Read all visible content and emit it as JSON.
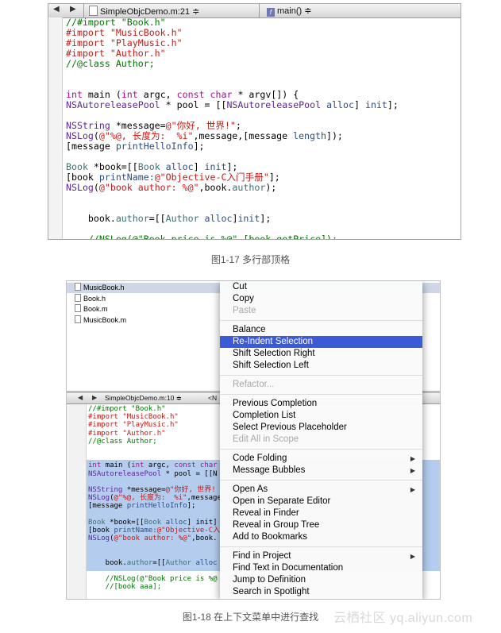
{
  "figure1": {
    "nav": {
      "back_arrow": "◀",
      "forward_arrow": "▶",
      "file_label": "SimpleObjcDemo.m:21 ≑",
      "function_label": "main() ≑",
      "function_icon": "f"
    },
    "code_lines": [
      {
        "y": 0,
        "parts": [
          {
            "t": "//#import \"Book.h\"",
            "c": "c-com"
          }
        ]
      },
      {
        "y": 1,
        "parts": [
          {
            "t": "#import ",
            "c": "c-red"
          },
          {
            "t": "\"MusicBook.h\"",
            "c": "c-red"
          }
        ]
      },
      {
        "y": 2,
        "parts": [
          {
            "t": "#import ",
            "c": "c-red"
          },
          {
            "t": "\"PlayMusic.h\"",
            "c": "c-red"
          }
        ]
      },
      {
        "y": 3,
        "parts": [
          {
            "t": "#import ",
            "c": "c-red"
          },
          {
            "t": "\"Author.h\"",
            "c": "c-red"
          }
        ]
      },
      {
        "y": 4,
        "parts": [
          {
            "t": "//@class Author;",
            "c": "c-com"
          }
        ]
      },
      {
        "y": 7,
        "parts": [
          {
            "t": "int",
            "c": "c-purple"
          },
          {
            "t": " main (",
            "c": ""
          },
          {
            "t": "int",
            "c": "c-purple"
          },
          {
            "t": " argc, ",
            "c": ""
          },
          {
            "t": "const",
            "c": "c-purple"
          },
          {
            "t": " ",
            "c": ""
          },
          {
            "t": "char",
            "c": "c-purple"
          },
          {
            "t": " * argv[]) {",
            "c": ""
          }
        ]
      },
      {
        "y": 8,
        "parts": [
          {
            "t": "NSAutoreleasePool",
            "c": "c-cls"
          },
          {
            "t": " * pool = [[",
            "c": ""
          },
          {
            "t": "NSAutoreleasePool",
            "c": "c-cls"
          },
          {
            "t": " ",
            "c": ""
          },
          {
            "t": "alloc",
            "c": "c-slate"
          },
          {
            "t": "] ",
            "c": ""
          },
          {
            "t": "init",
            "c": "c-slate"
          },
          {
            "t": "];",
            "c": ""
          }
        ]
      },
      {
        "y": 10,
        "parts": [
          {
            "t": "NSString",
            "c": "c-cls"
          },
          {
            "t": " *message=",
            "c": ""
          },
          {
            "t": "@\"你好, 世界!\"",
            "c": "c-red"
          },
          {
            "t": ";",
            "c": ""
          }
        ]
      },
      {
        "y": 11,
        "parts": [
          {
            "t": "NSLog",
            "c": "c-cls"
          },
          {
            "t": "(",
            "c": ""
          },
          {
            "t": "@\"%@, 长度为:  %i\"",
            "c": "c-red"
          },
          {
            "t": ",message,[message ",
            "c": ""
          },
          {
            "t": "length",
            "c": "c-slate"
          },
          {
            "t": "]);",
            "c": ""
          }
        ]
      },
      {
        "y": 12,
        "parts": [
          {
            "t": "[message ",
            "c": ""
          },
          {
            "t": "printHelloInfo",
            "c": "c-slate"
          },
          {
            "t": "];",
            "c": ""
          }
        ]
      },
      {
        "y": 14,
        "parts": [
          {
            "t": "Book",
            "c": "c-teal"
          },
          {
            "t": " *book=[[",
            "c": ""
          },
          {
            "t": "Book",
            "c": "c-teal"
          },
          {
            "t": " ",
            "c": ""
          },
          {
            "t": "alloc",
            "c": "c-slate"
          },
          {
            "t": "] ",
            "c": ""
          },
          {
            "t": "init",
            "c": "c-slate"
          },
          {
            "t": "];",
            "c": ""
          }
        ]
      },
      {
        "y": 15,
        "parts": [
          {
            "t": "[book ",
            "c": ""
          },
          {
            "t": "printName:",
            "c": "c-slate"
          },
          {
            "t": "@\"Objective-C入门手册\"",
            "c": "c-red"
          },
          {
            "t": "];",
            "c": ""
          }
        ]
      },
      {
        "y": 16,
        "parts": [
          {
            "t": "NSLog",
            "c": "c-cls"
          },
          {
            "t": "(",
            "c": ""
          },
          {
            "t": "@\"book author: %@\"",
            "c": "c-red"
          },
          {
            "t": ",book.",
            "c": ""
          },
          {
            "t": "author",
            "c": "c-teal"
          },
          {
            "t": ");",
            "c": ""
          }
        ]
      },
      {
        "y": 19,
        "parts": [
          {
            "t": "    book.",
            "c": ""
          },
          {
            "t": "author",
            "c": "c-teal"
          },
          {
            "t": "=[[",
            "c": ""
          },
          {
            "t": "Author",
            "c": "c-teal"
          },
          {
            "t": " ",
            "c": ""
          },
          {
            "t": "alloc",
            "c": "c-slate"
          },
          {
            "t": "]",
            "c": ""
          },
          {
            "t": "init",
            "c": "c-slate"
          },
          {
            "t": "];",
            "c": ""
          }
        ]
      },
      {
        "y": 21,
        "parts": [
          {
            "t": "    //NSLog(@\"Book price is %@\",[book getPrice]);",
            "c": "c-com"
          }
        ]
      }
    ]
  },
  "caption1": "图1-17 多行部顶格",
  "figure2": {
    "file_rows": [
      {
        "label": "MusicBook.h",
        "selected": true
      },
      {
        "label": "Book.h",
        "selected": false
      },
      {
        "label": "Book.m",
        "selected": false
      },
      {
        "label": "MusicBook.m",
        "selected": false
      }
    ],
    "nav": {
      "back_arrow": "◀",
      "forward_arrow": "▶",
      "file_label": "SimpleObjcDemo.m:10 ≑",
      "trailing_label": "<N"
    },
    "code_lines": [
      {
        "y": 0,
        "parts": [
          {
            "t": "//#import \"Book.h\"",
            "c": "c-com"
          }
        ]
      },
      {
        "y": 1,
        "parts": [
          {
            "t": "#import \"MusicBook.h\"",
            "c": "c-red"
          }
        ]
      },
      {
        "y": 2,
        "parts": [
          {
            "t": "#import \"PlayMusic.h\"",
            "c": "c-red"
          }
        ]
      },
      {
        "y": 3,
        "parts": [
          {
            "t": "#import \"Author.h\"",
            "c": "c-red"
          }
        ]
      },
      {
        "y": 4,
        "parts": [
          {
            "t": "//@class Author;",
            "c": "c-com"
          }
        ]
      },
      {
        "y": 7,
        "parts": [
          {
            "t": "int",
            "c": "c-purple"
          },
          {
            "t": " main (",
            "c": ""
          },
          {
            "t": "int",
            "c": "c-purple"
          },
          {
            "t": " argc, ",
            "c": ""
          },
          {
            "t": "const",
            "c": "c-purple"
          },
          {
            "t": " char",
            "c": "c-purple"
          }
        ]
      },
      {
        "y": 8,
        "parts": [
          {
            "t": "NSAutoreleasePool",
            "c": "c-cls"
          },
          {
            "t": " * pool = [[N",
            "c": ""
          }
        ]
      },
      {
        "y": 10,
        "parts": [
          {
            "t": "NSString",
            "c": "c-cls"
          },
          {
            "t": " *message=",
            "c": ""
          },
          {
            "t": "@\"你好, 世界! \"",
            "c": "c-red"
          }
        ]
      },
      {
        "y": 11,
        "parts": [
          {
            "t": "NSLog",
            "c": "c-cls"
          },
          {
            "t": "(",
            "c": ""
          },
          {
            "t": "@\"%@, 长度为:  %i\"",
            "c": "c-red"
          },
          {
            "t": ",message",
            "c": ""
          }
        ]
      },
      {
        "y": 12,
        "parts": [
          {
            "t": "[message ",
            "c": ""
          },
          {
            "t": "printHelloInfo",
            "c": "c-slate"
          },
          {
            "t": "];",
            "c": ""
          }
        ]
      },
      {
        "y": 14,
        "parts": [
          {
            "t": "Book",
            "c": "c-teal"
          },
          {
            "t": " *book=[[",
            "c": ""
          },
          {
            "t": "Book",
            "c": "c-teal"
          },
          {
            "t": " ",
            "c": ""
          },
          {
            "t": "alloc",
            "c": "c-slate"
          },
          {
            "t": "] init]",
            "c": ""
          }
        ]
      },
      {
        "y": 15,
        "parts": [
          {
            "t": "[book ",
            "c": ""
          },
          {
            "t": "printName:",
            "c": "c-slate"
          },
          {
            "t": "@\"Objective-C入",
            "c": "c-red"
          }
        ]
      },
      {
        "y": 16,
        "parts": [
          {
            "t": "NSLog",
            "c": "c-cls"
          },
          {
            "t": "(",
            "c": ""
          },
          {
            "t": "@\"book author: %@\"",
            "c": "c-red"
          },
          {
            "t": ",book.",
            "c": ""
          }
        ]
      },
      {
        "y": 19,
        "parts": [
          {
            "t": "    book.",
            "c": ""
          },
          {
            "t": "author",
            "c": "c-teal"
          },
          {
            "t": "=[[",
            "c": ""
          },
          {
            "t": "Author",
            "c": "c-teal"
          },
          {
            "t": " alloc",
            "c": "c-slate"
          }
        ]
      },
      {
        "y": 21,
        "parts": [
          {
            "t": "    //NSLog(@\"Book price is %@",
            "c": "c-com"
          }
        ]
      },
      {
        "y": 22,
        "parts": [
          {
            "t": "    //[book aaa];",
            "c": "c-com"
          }
        ]
      }
    ]
  },
  "context_menu": {
    "items": [
      {
        "label": "Cut",
        "state": "normal",
        "submenu": false
      },
      {
        "label": "Copy",
        "state": "normal",
        "submenu": false
      },
      {
        "label": "Paste",
        "state": "disabled",
        "submenu": false
      },
      {
        "divider": true
      },
      {
        "label": "Balance",
        "state": "normal",
        "submenu": false
      },
      {
        "label": "Re-Indent Selection",
        "state": "selected",
        "submenu": false
      },
      {
        "label": "Shift Selection Right",
        "state": "normal",
        "submenu": false
      },
      {
        "label": "Shift Selection Left",
        "state": "normal",
        "submenu": false
      },
      {
        "divider": true
      },
      {
        "label": "Refactor...",
        "state": "disabled",
        "submenu": false
      },
      {
        "divider": true
      },
      {
        "label": "Previous Completion",
        "state": "normal",
        "submenu": false
      },
      {
        "label": "Completion List",
        "state": "normal",
        "submenu": false
      },
      {
        "label": "Select Previous Placeholder",
        "state": "normal",
        "submenu": false
      },
      {
        "label": "Edit All in Scope",
        "state": "disabled",
        "submenu": false
      },
      {
        "divider": true
      },
      {
        "label": "Code Folding",
        "state": "normal",
        "submenu": true
      },
      {
        "label": "Message Bubbles",
        "state": "normal",
        "submenu": true
      },
      {
        "divider": true
      },
      {
        "label": "Open As",
        "state": "normal",
        "submenu": true
      },
      {
        "label": "Open in Separate Editor",
        "state": "normal",
        "submenu": false
      },
      {
        "label": "Reveal in Finder",
        "state": "normal",
        "submenu": false
      },
      {
        "label": "Reveal in Group Tree",
        "state": "normal",
        "submenu": false
      },
      {
        "label": "Add to Bookmarks",
        "state": "normal",
        "submenu": false
      },
      {
        "divider": true
      },
      {
        "label": "Find in Project",
        "state": "normal",
        "submenu": true
      },
      {
        "label": "Find Text in Documentation",
        "state": "normal",
        "submenu": false
      },
      {
        "label": "Jump to Definition",
        "state": "normal",
        "submenu": false
      },
      {
        "label": "Search in Spotlight",
        "state": "normal",
        "submenu": false
      }
    ],
    "submenu_glyph": "▶"
  },
  "caption2": "图1-18 在上下文菜单中进行查找",
  "watermark": "云栖社区 yq.aliyun.com"
}
